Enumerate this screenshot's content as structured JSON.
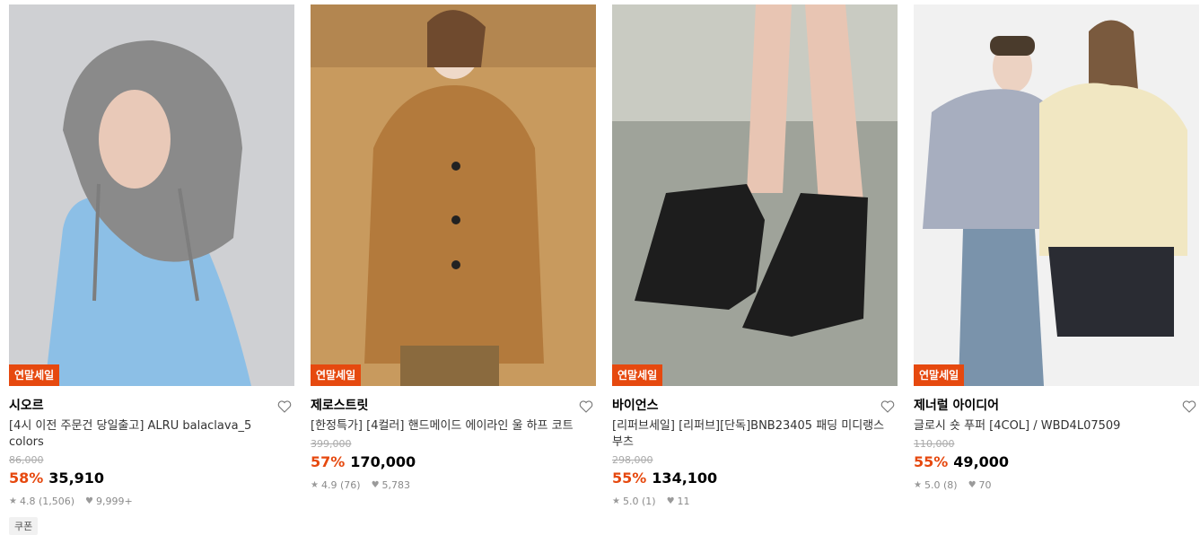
{
  "products": [
    {
      "badge": "연말세일",
      "brand": "시오르",
      "name": "[4시 이전 주문건 당일출고] ALRU balaclava_5 colors",
      "original_price": "86,000",
      "discount": "58%",
      "price": "35,910",
      "rating": "4.8",
      "review_count": "(1,506)",
      "likes": "9,999+",
      "coupon": "쿠폰",
      "image_icon": "product-photo-hooded-balaclava"
    },
    {
      "badge": "연말세일",
      "brand": "제로스트릿",
      "name": "[한정특가] [4컬러] 핸드메이드 에이라인 울 하프 코트",
      "original_price": "399,000",
      "discount": "57%",
      "price": "170,000",
      "rating": "4.9",
      "review_count": "(76)",
      "likes": "5,783",
      "image_icon": "product-photo-camel-coat"
    },
    {
      "badge": "연말세일",
      "brand": "바이언스",
      "name": "[리퍼브세일] [리퍼브][단독]BNB23405 패딩 미디랭스 부츠",
      "original_price": "298,000",
      "discount": "55%",
      "price": "134,100",
      "rating": "5.0",
      "review_count": "(1)",
      "likes": "11",
      "image_icon": "product-photo-padded-boots"
    },
    {
      "badge": "연말세일",
      "brand": "제너럴 아이디어",
      "name": "글로시 숏 푸퍼 [4COL] / WBD4L07509",
      "original_price": "110,000",
      "discount": "55%",
      "price": "49,000",
      "rating": "5.0",
      "review_count": "(8)",
      "likes": "70",
      "image_icon": "product-photo-glossy-puffers"
    }
  ],
  "colors": {
    "accent": "#e6490f",
    "muted": "#8a8a8a"
  }
}
